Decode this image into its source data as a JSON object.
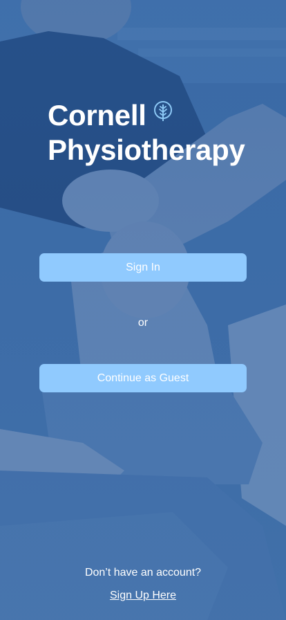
{
  "brand": {
    "title_line1": "Cornell",
    "title_line2": "Physiotherapy",
    "logo_icon": "leaf-icon"
  },
  "auth": {
    "sign_in_label": "Sign In",
    "separator": "or",
    "guest_label": "Continue as Guest"
  },
  "footer": {
    "question": "Don’t have an account?",
    "signup_link": "Sign Up Here"
  },
  "colors": {
    "overlay_blue": "#2d5fa0",
    "button_fill": "#90cafe",
    "text": "#ffffff"
  },
  "background_image": "physiotherapist-treating-knee-photo"
}
